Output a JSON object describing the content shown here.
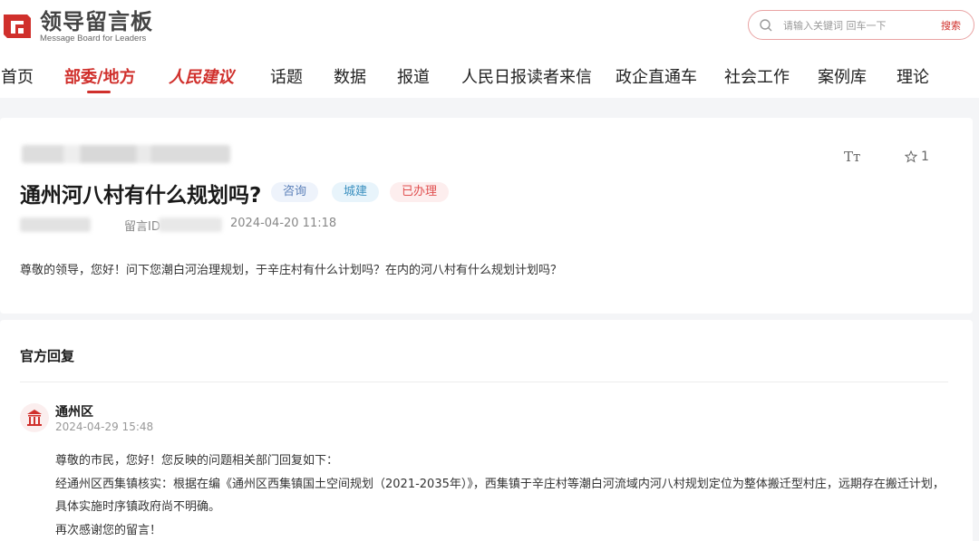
{
  "header": {
    "logo_title": "领导留言板",
    "logo_subtitle": "Message Board for Leaders",
    "search_placeholder": "请输入关键词 回车一下",
    "search_button": "搜索"
  },
  "nav": {
    "items": [
      "首页",
      "部委/地方",
      "人民建议",
      "话题",
      "数据",
      "报道",
      "人民日报读者来信",
      "政企直通车",
      "社会工作",
      "案例库",
      "理论"
    ],
    "active_index": 1
  },
  "message": {
    "title": "通州河八村有什么规划吗?",
    "tags": [
      "咨询",
      "城建",
      "已办理"
    ],
    "id_label": "留言ID",
    "date": "2024-04-20 11:18",
    "font_toggle": "Tт",
    "favorite_count": "1",
    "body": "尊敬的领导，您好！问下您潮白河治理规划，于辛庄村有什么计划吗？在内的河八村有什么规划计划吗？"
  },
  "reply": {
    "section_title": "官方回复",
    "org_name": "通州区",
    "date": "2024-04-29 15:48",
    "lines": [
      "尊敬的市民，您好！您反映的问题相关部门回复如下：",
      "经通州区西集镇核实：根据在编《通州区西集镇国土空间规划（2021-2035年）》，西集镇于辛庄村等潮白河流域内河八村规划定位为整体搬迁型村庄，远期存在搬迁计划，",
      "具体实施时序镇政府尚不明确。",
      "再次感谢您的留言！"
    ]
  },
  "colors": {
    "brand_red": "#d0302c",
    "tag_consult_text": "#5a7fb8",
    "tag_city_text": "#3a8fbf",
    "tag_done_text": "#e05050"
  }
}
